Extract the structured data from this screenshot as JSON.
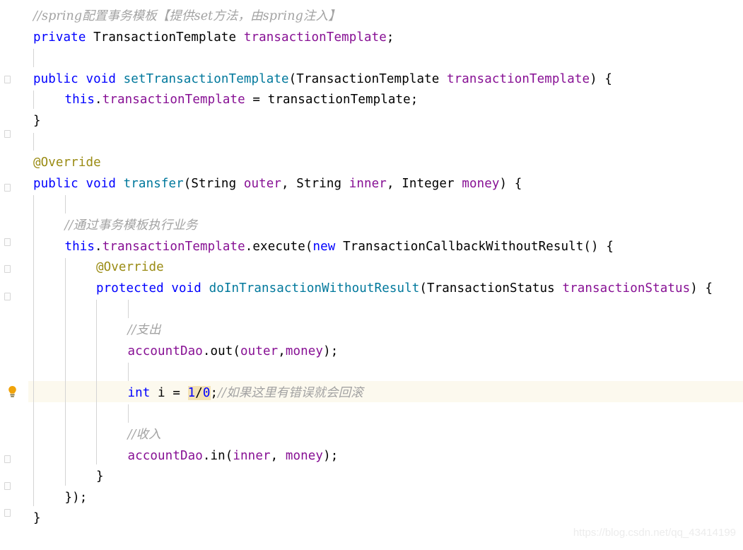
{
  "editor": {
    "background": "#ffffff",
    "highlight_line_background": "#fcf9ee",
    "selection_background": "#f3e2b5",
    "colors": {
      "keyword": "#0000ff",
      "method": "#00789c",
      "field": "#871094",
      "annotation": "#9a8b13",
      "comment": "#a3a3a3",
      "number": "#0000ff",
      "plain": "#000000",
      "indent_guide": "#d4d4d4",
      "bulb": "#f0a30a"
    },
    "gutter": {
      "bulb_icon": "lightbulb-icon",
      "fold_markers": [
        "fold-marker",
        "fold-marker",
        "fold-marker",
        "fold-marker",
        "fold-marker"
      ]
    }
  },
  "code": {
    "language": "java",
    "lines": [
      {
        "n": 1,
        "indent": 1,
        "tokens": [
          {
            "t": "//spring配置事务模板【提供set方法，由spring注入】",
            "c": "cmt"
          }
        ]
      },
      {
        "n": 2,
        "indent": 1,
        "tokens": [
          {
            "t": "private",
            "c": "kw"
          },
          {
            "t": " TransactionTemplate ",
            "c": "plain"
          },
          {
            "t": "transactionTemplate",
            "c": "fld"
          },
          {
            "t": ";",
            "c": "plain"
          }
        ]
      },
      {
        "n": 3,
        "indent": 1,
        "tokens": []
      },
      {
        "n": 4,
        "indent": 1,
        "tokens": [
          {
            "t": "public",
            "c": "kw"
          },
          {
            "t": " ",
            "c": "plain"
          },
          {
            "t": "void",
            "c": "kw"
          },
          {
            "t": " ",
            "c": "plain"
          },
          {
            "t": "setTransactionTemplate",
            "c": "meth"
          },
          {
            "t": "(TransactionTemplate ",
            "c": "plain"
          },
          {
            "t": "transactionTemplate",
            "c": "fld"
          },
          {
            "t": ") {",
            "c": "plain"
          }
        ]
      },
      {
        "n": 5,
        "indent": 2,
        "tokens": [
          {
            "t": "this",
            "c": "kw"
          },
          {
            "t": ".",
            "c": "plain"
          },
          {
            "t": "transactionTemplate",
            "c": "fld"
          },
          {
            "t": " = ",
            "c": "plain"
          },
          {
            "t": "transactionTemplate",
            "c": "plain"
          },
          {
            "t": ";",
            "c": "plain"
          }
        ]
      },
      {
        "n": 6,
        "indent": 1,
        "tokens": [
          {
            "t": "}",
            "c": "plain"
          }
        ]
      },
      {
        "n": 7,
        "indent": 1,
        "tokens": []
      },
      {
        "n": 8,
        "indent": 1,
        "tokens": [
          {
            "t": "@Override",
            "c": "anno"
          }
        ]
      },
      {
        "n": 9,
        "indent": 1,
        "tokens": [
          {
            "t": "public",
            "c": "kw"
          },
          {
            "t": " ",
            "c": "plain"
          },
          {
            "t": "void",
            "c": "kw"
          },
          {
            "t": " ",
            "c": "plain"
          },
          {
            "t": "transfer",
            "c": "meth"
          },
          {
            "t": "(String ",
            "c": "plain"
          },
          {
            "t": "outer",
            "c": "fld"
          },
          {
            "t": ", String ",
            "c": "plain"
          },
          {
            "t": "inner",
            "c": "fld"
          },
          {
            "t": ", Integer ",
            "c": "plain"
          },
          {
            "t": "money",
            "c": "fld"
          },
          {
            "t": ") {",
            "c": "plain"
          }
        ]
      },
      {
        "n": 10,
        "indent": 2,
        "tokens": []
      },
      {
        "n": 11,
        "indent": 2,
        "tokens": [
          {
            "t": "//通过事务模板执行业务",
            "c": "cmt"
          }
        ]
      },
      {
        "n": 12,
        "indent": 2,
        "tokens": [
          {
            "t": "this",
            "c": "kw"
          },
          {
            "t": ".",
            "c": "plain"
          },
          {
            "t": "transactionTemplate",
            "c": "fld"
          },
          {
            "t": ".execute(",
            "c": "plain"
          },
          {
            "t": "new",
            "c": "kw"
          },
          {
            "t": " TransactionCallbackWithoutResult() {",
            "c": "plain"
          }
        ]
      },
      {
        "n": 13,
        "indent": 3,
        "tokens": [
          {
            "t": "@Override",
            "c": "anno"
          }
        ]
      },
      {
        "n": 14,
        "indent": 3,
        "tokens": [
          {
            "t": "protected",
            "c": "kw"
          },
          {
            "t": " ",
            "c": "plain"
          },
          {
            "t": "void",
            "c": "kw"
          },
          {
            "t": " ",
            "c": "plain"
          },
          {
            "t": "doInTransactionWithoutResult",
            "c": "meth"
          },
          {
            "t": "(TransactionStatus ",
            "c": "plain"
          },
          {
            "t": "transactionStatus",
            "c": "fld"
          },
          {
            "t": ") {",
            "c": "plain"
          }
        ]
      },
      {
        "n": 15,
        "indent": 4,
        "tokens": []
      },
      {
        "n": 16,
        "indent": 4,
        "tokens": [
          {
            "t": "//支出",
            "c": "cmt"
          }
        ]
      },
      {
        "n": 17,
        "indent": 4,
        "tokens": [
          {
            "t": "accountDao",
            "c": "fld"
          },
          {
            "t": ".out(",
            "c": "plain"
          },
          {
            "t": "outer",
            "c": "fld"
          },
          {
            "t": ",",
            "c": "plain"
          },
          {
            "t": "money",
            "c": "fld"
          },
          {
            "t": ");",
            "c": "plain"
          }
        ]
      },
      {
        "n": 18,
        "indent": 4,
        "tokens": []
      },
      {
        "n": 19,
        "indent": 4,
        "highlighted": true,
        "tokens": [
          {
            "t": "int",
            "c": "kw"
          },
          {
            "t": " i = ",
            "c": "plain"
          },
          {
            "t": "1",
            "c": "num hl"
          },
          {
            "t": "/",
            "c": "plain hl"
          },
          {
            "t": "0",
            "c": "num hl"
          },
          {
            "t": ";",
            "c": "plain"
          },
          {
            "t": "//如果这里有错误就会回滚",
            "c": "cmt"
          }
        ]
      },
      {
        "n": 20,
        "indent": 4,
        "tokens": []
      },
      {
        "n": 21,
        "indent": 4,
        "tokens": [
          {
            "t": "//收入",
            "c": "cmt"
          }
        ]
      },
      {
        "n": 22,
        "indent": 4,
        "tokens": [
          {
            "t": "accountDao",
            "c": "fld"
          },
          {
            "t": ".in(",
            "c": "plain"
          },
          {
            "t": "inner",
            "c": "fld"
          },
          {
            "t": ", ",
            "c": "plain"
          },
          {
            "t": "money",
            "c": "fld"
          },
          {
            "t": ");",
            "c": "plain"
          }
        ]
      },
      {
        "n": 23,
        "indent": 3,
        "tokens": [
          {
            "t": "}",
            "c": "plain"
          }
        ]
      },
      {
        "n": 24,
        "indent": 2,
        "tokens": [
          {
            "t": "});",
            "c": "plain"
          }
        ]
      },
      {
        "n": 25,
        "indent": 1,
        "tokens": [
          {
            "t": "}",
            "c": "plain"
          }
        ]
      },
      {
        "n": 26,
        "indent": 0,
        "tokens": [
          {
            "t": "}",
            "c": "plain"
          }
        ]
      }
    ]
  },
  "watermark": {
    "text": "https://blog.csdn.net/qq_43414199"
  }
}
